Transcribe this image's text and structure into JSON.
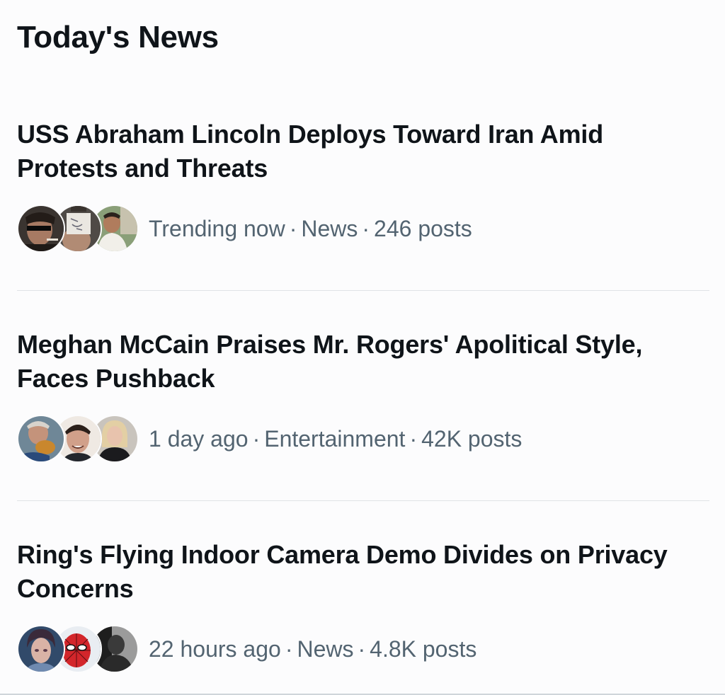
{
  "section": {
    "title": "Today's News"
  },
  "stories": [
    {
      "headline": "USS Abraham Lincoln Deploys Toward Iran Amid Protests and Threats",
      "time": "Trending now",
      "category": "News",
      "posts": "246 posts",
      "separator": "·",
      "avatars": [
        "avatar-man-sunglasses",
        "avatar-person-sign",
        "avatar-man-outdoors"
      ]
    },
    {
      "headline": "Meghan McCain Praises Mr. Rogers' Apolitical Style, Faces Pushback",
      "time": "1 day ago",
      "category": "Entertainment",
      "posts": "42K posts",
      "separator": "·",
      "avatars": [
        "avatar-man-eating",
        "avatar-man-smiling",
        "avatar-woman-blonde"
      ]
    },
    {
      "headline": "Ring's Flying Indoor Camera Demo Divides on Privacy Concerns",
      "time": "22 hours ago",
      "category": "News",
      "posts": "4.8K posts",
      "separator": "·",
      "avatars": [
        "avatar-anime-character",
        "avatar-spiderman",
        "avatar-dark-figure"
      ]
    }
  ],
  "colors": {
    "background": "#fcfcfd",
    "text_primary": "#0f1419",
    "text_secondary": "#536471",
    "divider": "#dfe3e6"
  }
}
